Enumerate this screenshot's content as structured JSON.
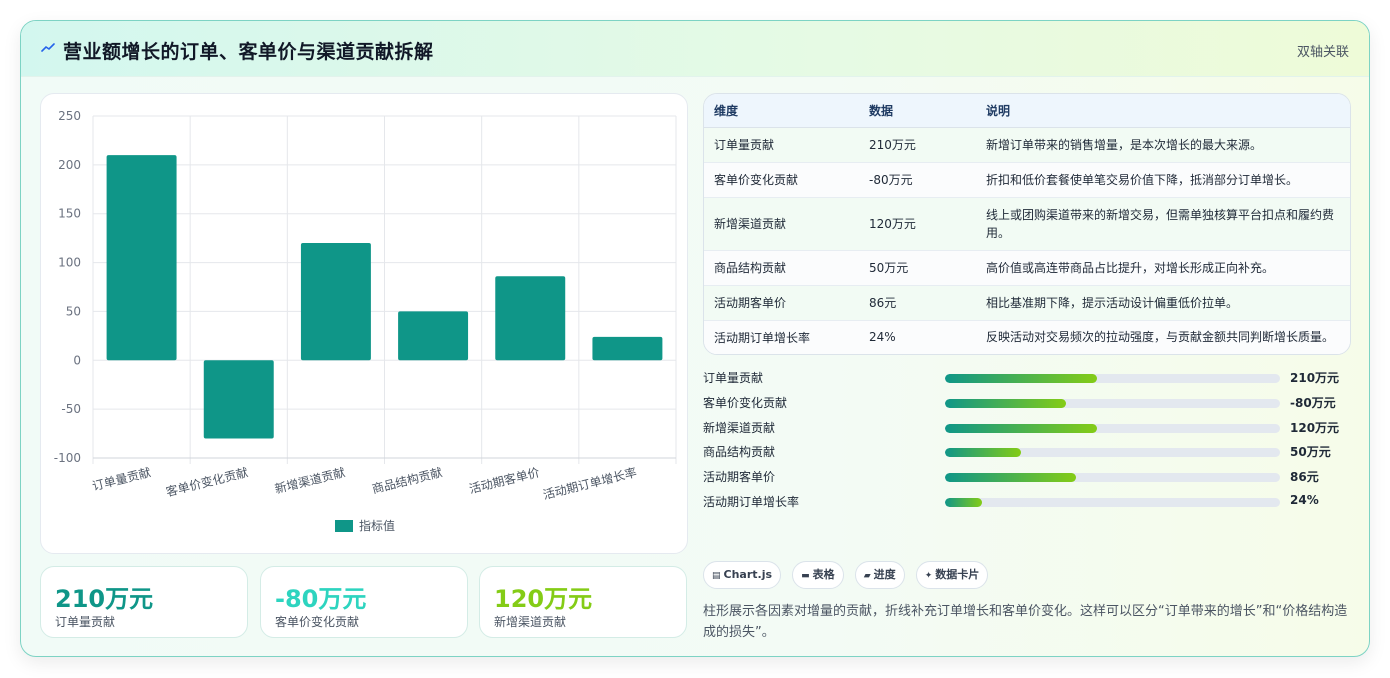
{
  "header": {
    "title": "营业额增长的订单、客单价与渠道贡献拆解",
    "badge": "双轴关联"
  },
  "chart_data": {
    "type": "bar",
    "categories": [
      "订单量贡献",
      "客单价变化贡献",
      "新增渠道贡献",
      "商品结构贡献",
      "活动期客单价",
      "活动期订单增长率"
    ],
    "series": [
      {
        "name": "指标值",
        "values": [
          210,
          -80,
          120,
          50,
          86,
          24
        ]
      }
    ],
    "ylim": [
      -100,
      250
    ],
    "yticks": [
      250,
      200,
      150,
      100,
      50,
      0,
      -50,
      -100
    ],
    "grid": true,
    "legend": "bottom",
    "bar_color": "#0f9688"
  },
  "stats": [
    {
      "value": "210万元",
      "label": "订单量贡献",
      "color": "#0f9688"
    },
    {
      "value": "-80万元",
      "label": "客单价变化贡献",
      "color": "#2dd4bf"
    },
    {
      "value": "120万元",
      "label": "新增渠道贡献",
      "color": "#84cc16"
    }
  ],
  "table": {
    "headers": [
      "维度",
      "数据",
      "说明"
    ],
    "rows": [
      [
        "订单量贡献",
        "210万元",
        "新增订单带来的销售增量，是本次增长的最大来源。"
      ],
      [
        "客单价变化贡献",
        "-80万元",
        "折扣和低价套餐使单笔交易价值下降，抵消部分订单增长。"
      ],
      [
        "新增渠道贡献",
        "120万元",
        "线上或团购渠道带来的新增交易，但需单独核算平台扣点和履约费用。"
      ],
      [
        "商品结构贡献",
        "50万元",
        "高价值或高连带商品占比提升，对增长形成正向补充。"
      ],
      [
        "活动期客单价",
        "86元",
        "相比基准期下降，提示活动设计偏重低价拉单。"
      ],
      [
        "活动期订单增长率",
        "24%",
        "反映活动对交易频次的拉动强度，与贡献金额共同判断增长质量。"
      ]
    ]
  },
  "progress": [
    {
      "label": "订单量贡献",
      "value": "210万元",
      "fraction": 0.455
    },
    {
      "label": "客单价变化贡献",
      "value": "-80万元",
      "fraction": 0.36
    },
    {
      "label": "新增渠道贡献",
      "value": "120万元",
      "fraction": 0.455
    },
    {
      "label": "商品结构贡献",
      "value": "50万元",
      "fraction": 0.228
    },
    {
      "label": "活动期客单价",
      "value": "86元",
      "fraction": 0.392
    },
    {
      "label": "活动期订单增长率",
      "value": "24%",
      "fraction": 0.11
    }
  ],
  "chips": [
    {
      "icon": "chart-icon",
      "glyph": "▤",
      "label": "Chart.js"
    },
    {
      "icon": "table-icon",
      "glyph": "▬",
      "label": "表格"
    },
    {
      "icon": "progress-icon",
      "glyph": "▰",
      "label": "进度"
    },
    {
      "icon": "sparkle-icon",
      "glyph": "✦",
      "label": "数据卡片"
    }
  ],
  "note": "柱形展示各因素对增量的贡献，折线补充订单增长和客单价变化。这样可以区分“订单带来的增长”和“价格结构造成的损失”。"
}
